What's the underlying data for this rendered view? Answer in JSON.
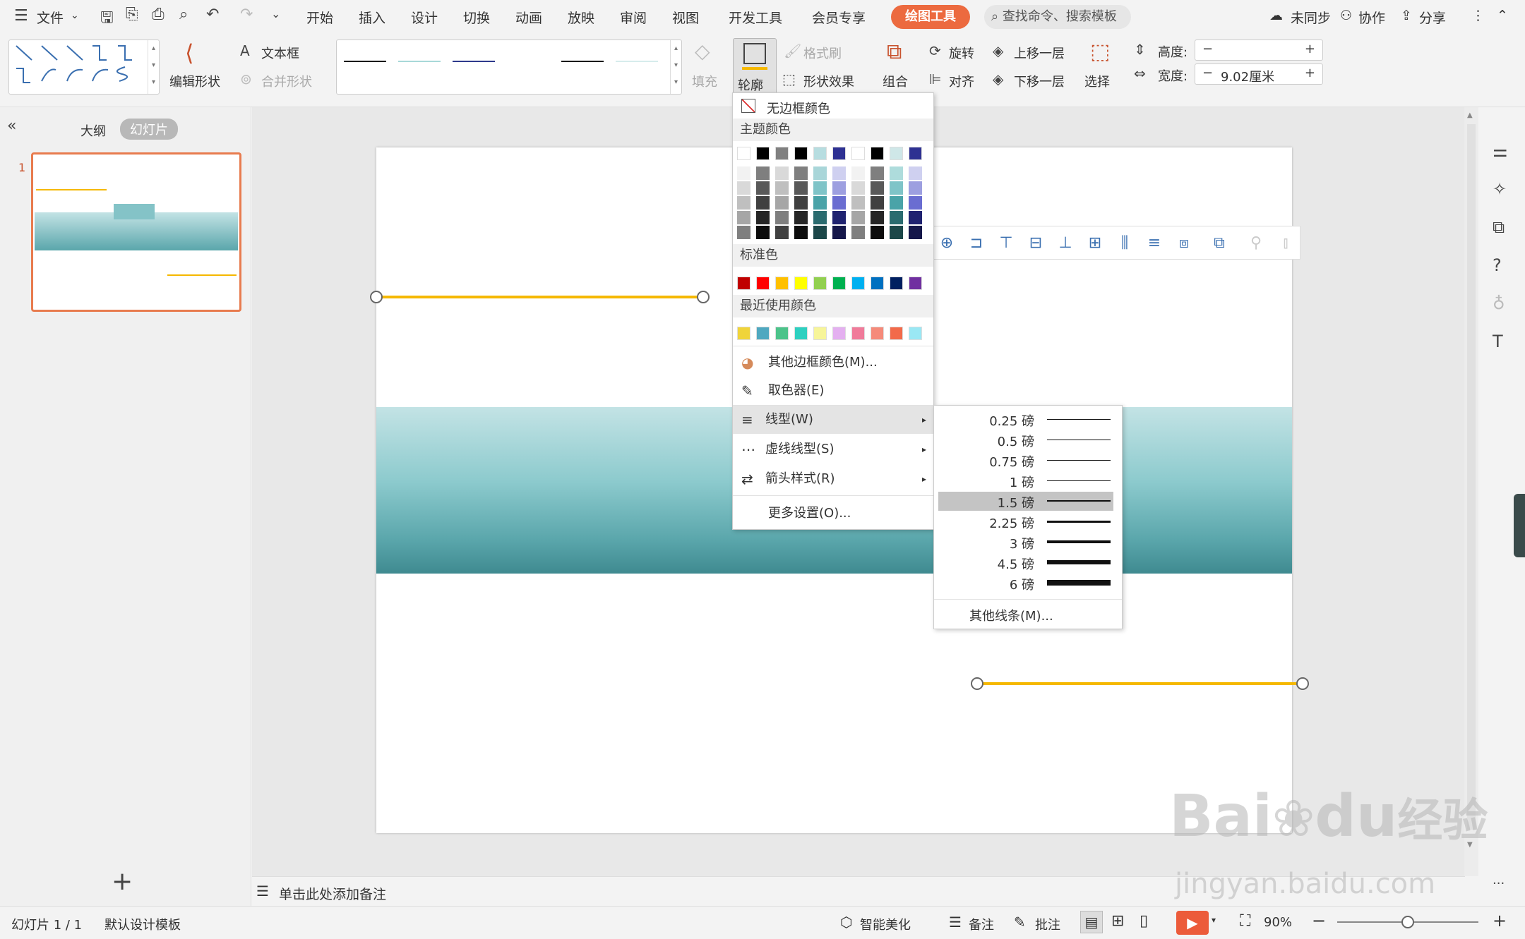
{
  "menubar": {
    "file_label": "文件",
    "tabs": [
      "开始",
      "插入",
      "设计",
      "切换",
      "动画",
      "放映",
      "审阅",
      "视图",
      "开发工具",
      "会员专享"
    ],
    "drawing_tools_tab": "绘图工具",
    "search_placeholder": "查找命令、搜索模板",
    "sync_label": "未同步",
    "collab_label": "协作",
    "share_label": "分享"
  },
  "ribbon": {
    "edit_shape": "编辑形状",
    "text_box": "文本框",
    "merge_shape": "合并形状",
    "fill": "填充",
    "outline": "轮廓",
    "format_painter": "格式刷",
    "shape_effect": "形状效果",
    "group": "组合",
    "rotate": "旋转",
    "align": "对齐",
    "bring_forward": "上移一层",
    "send_backward": "下移一层",
    "select": "选择",
    "height_label": "高度:",
    "height_value": "",
    "width_label": "宽度:",
    "width_value": "9.02厘米",
    "line_style_colors": [
      "#111111",
      "#a8d8d8",
      "#2e3a8c",
      "#ffffff",
      "#111111",
      "#d6ecec"
    ]
  },
  "left_panel": {
    "outline_tab": "大纲",
    "slides_tab": "幻灯片",
    "slide_number": "1",
    "add_icon": "plus-icon"
  },
  "notes_placeholder": "单击此处添加备注",
  "outline_dropdown": {
    "no_border_color": "无边框颜色",
    "theme_colors_title": "主题颜色",
    "theme_top_row": [
      "#ffffff",
      "#000000",
      "#808080",
      "#000000",
      "#b7dde0",
      "#2e3192",
      "#ffffff",
      "#000000",
      "#cfe7e8",
      "#2e3192"
    ],
    "theme_shades": [
      [
        "#f2f2f2",
        "#7f7f7f",
        "#d9d9d9",
        "#7f7f7f",
        "#a9d6d9",
        "#cfd0f0",
        "#f2f2f2",
        "#7f7f7f",
        "#aedcdc",
        "#cfd0f0"
      ],
      [
        "#d9d9d9",
        "#595959",
        "#bfbfbf",
        "#595959",
        "#7fc4c8",
        "#9d9fe0",
        "#d9d9d9",
        "#595959",
        "#7fc4c8",
        "#9d9fe0"
      ],
      [
        "#bfbfbf",
        "#404040",
        "#a6a6a6",
        "#404040",
        "#4aa3a8",
        "#6a6dd1",
        "#bfbfbf",
        "#404040",
        "#4aa3a8",
        "#6a6dd1"
      ],
      [
        "#a6a6a6",
        "#262626",
        "#7f7f7f",
        "#262626",
        "#2a6b6f",
        "#1f2270",
        "#a6a6a6",
        "#262626",
        "#2a6b6f",
        "#1f2270"
      ],
      [
        "#7f7f7f",
        "#0d0d0d",
        "#404040",
        "#0d0d0d",
        "#1c4749",
        "#15174a",
        "#7f7f7f",
        "#0d0d0d",
        "#1c4749",
        "#15174a"
      ]
    ],
    "standard_colors_title": "标准色",
    "standard_colors": [
      "#c00000",
      "#ff0000",
      "#ffc000",
      "#ffff00",
      "#92d050",
      "#00b050",
      "#00b0f0",
      "#0070c0",
      "#002060",
      "#7030a0"
    ],
    "recent_colors_title": "最近使用颜色",
    "recent_colors": [
      "#f0d43a",
      "#4fa8c0",
      "#4cc38a",
      "#2ed0c0",
      "#f7f59a",
      "#e4b0f0",
      "#f07b9a",
      "#f58a7a",
      "#f26a4a",
      "#9ae8f4"
    ],
    "more_border_colors": "其他边框颜色(M)...",
    "eyedropper": "取色器(E)",
    "line_type": "线型(W)",
    "dash_type": "虚线线型(S)",
    "arrow_style": "箭头样式(R)",
    "more_settings": "更多设置(O)..."
  },
  "line_weight_submenu": {
    "items": [
      {
        "label": "0.25 磅",
        "weight": 0.25
      },
      {
        "label": "0.5 磅",
        "weight": 0.5
      },
      {
        "label": "0.75 磅",
        "weight": 0.75
      },
      {
        "label": "1 磅",
        "weight": 1
      },
      {
        "label": "1.5 磅",
        "weight": 1.5
      },
      {
        "label": "2.25 磅",
        "weight": 2.25
      },
      {
        "label": "3 磅",
        "weight": 3
      },
      {
        "label": "4.5 磅",
        "weight": 4.5
      },
      {
        "label": "6 磅",
        "weight": 6
      }
    ],
    "selected_label": "1.5 磅",
    "other_lines": "其他线条(M)..."
  },
  "statusbar": {
    "slide_counter": "幻灯片 1 / 1",
    "template": "默认设计模板",
    "smart_beautify": "智能美化",
    "notes": "备注",
    "comments": "批注",
    "zoom": "90%",
    "zoom_level": 0.5
  },
  "colors": {
    "accent": "#ec6a3f",
    "line_yellow": "#f5b800",
    "band_top": "#c3e3e5",
    "band_bottom": "#4e9da3"
  },
  "watermark": {
    "brand": "Bai",
    "brand_suffix": "经验",
    "url": "jingyan.baidu.com"
  }
}
